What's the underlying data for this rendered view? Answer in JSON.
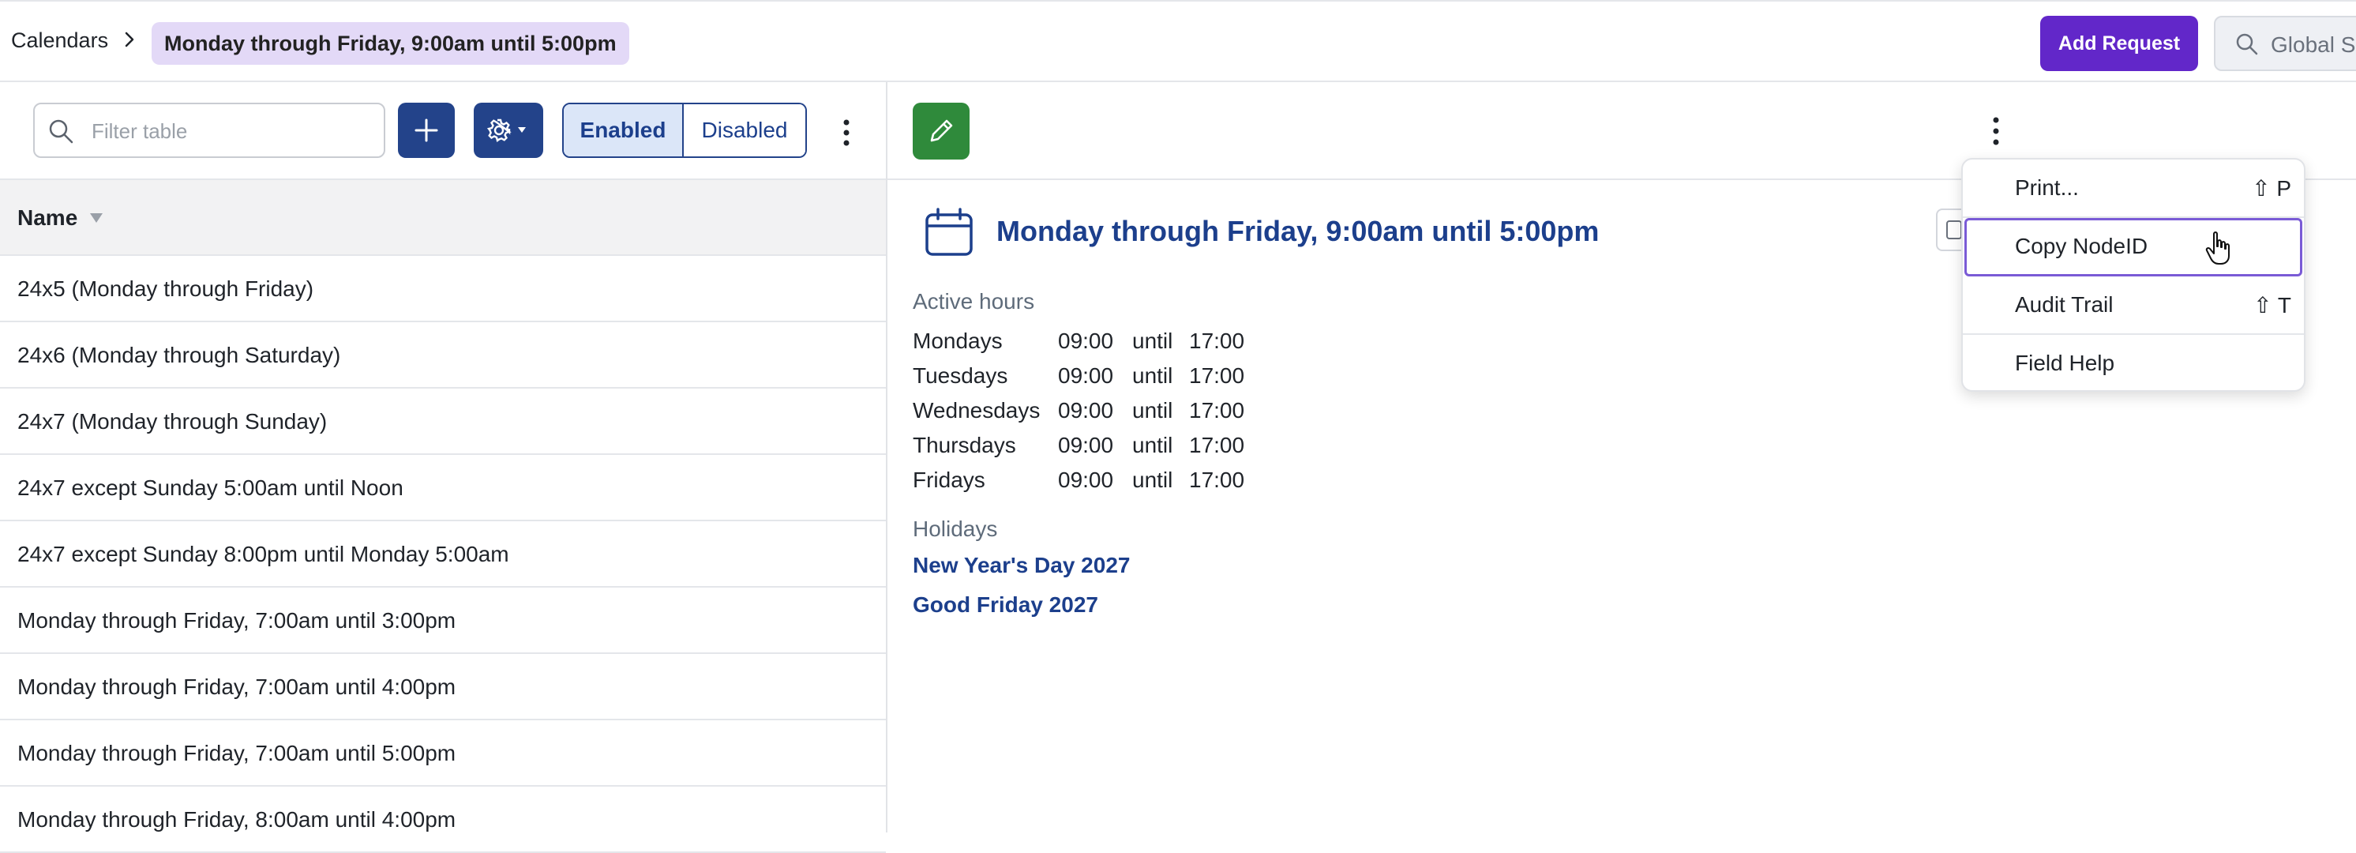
{
  "breadcrumb": {
    "root": "Calendars",
    "current": "Monday through Friday, 9:00am until 5:00pm"
  },
  "header": {
    "add_request_label": "Add Request",
    "global_search_text": "Global S"
  },
  "left_panel": {
    "filter_placeholder": "Filter table",
    "toggle_enabled": "Enabled",
    "toggle_disabled": "Disabled",
    "column_header": "Name",
    "rows": [
      "24x5 (Monday through Friday)",
      "24x6 (Monday through Saturday)",
      "24x7 (Monday through Sunday)",
      "24x7 except Sunday 5:00am until Noon",
      "24x7 except Sunday 8:00pm until Monday 5:00am",
      "Monday through Friday, 7:00am until 3:00pm",
      "Monday through Friday, 7:00am until 4:00pm",
      "Monday through Friday, 7:00am until 5:00pm",
      "Monday through Friday, 8:00am until 4:00pm"
    ]
  },
  "detail": {
    "title": "Monday through Friday, 9:00am until 5:00pm",
    "active_hours_label": "Active hours",
    "hours": [
      {
        "day": "Mondays",
        "start": "09:00",
        "sep": "until",
        "end": "17:00"
      },
      {
        "day": "Tuesdays",
        "start": "09:00",
        "sep": "until",
        "end": "17:00"
      },
      {
        "day": "Wednesdays",
        "start": "09:00",
        "sep": "until",
        "end": "17:00"
      },
      {
        "day": "Thursdays",
        "start": "09:00",
        "sep": "until",
        "end": "17:00"
      },
      {
        "day": "Fridays",
        "start": "09:00",
        "sep": "until",
        "end": "17:00"
      }
    ],
    "holidays_label": "Holidays",
    "holidays": [
      "New Year's Day 2027",
      "Good Friday 2027"
    ]
  },
  "menu": {
    "items": [
      {
        "label": "Print...",
        "shortcut": "⇧ P"
      },
      {
        "label": "Copy NodeID",
        "shortcut": ""
      },
      {
        "label": "Audit Trail",
        "shortcut": "⇧ T"
      },
      {
        "label": "Field Help",
        "shortcut": ""
      }
    ]
  },
  "colors": {
    "brand_purple": "#6227c9",
    "primary_navy": "#23438a",
    "edit_green": "#2f8a3b",
    "link_blue": "#1c3f8c",
    "breadcrumb_chip": "#e3d9f7"
  },
  "icons": [
    "chevron-right-icon",
    "search-icon",
    "plus-icon",
    "gear-icon",
    "caret-down-icon",
    "kebab-icon",
    "sort-down-icon",
    "pencil-icon",
    "calendar-icon",
    "clipboard-icon",
    "hand-pointer-icon"
  ]
}
